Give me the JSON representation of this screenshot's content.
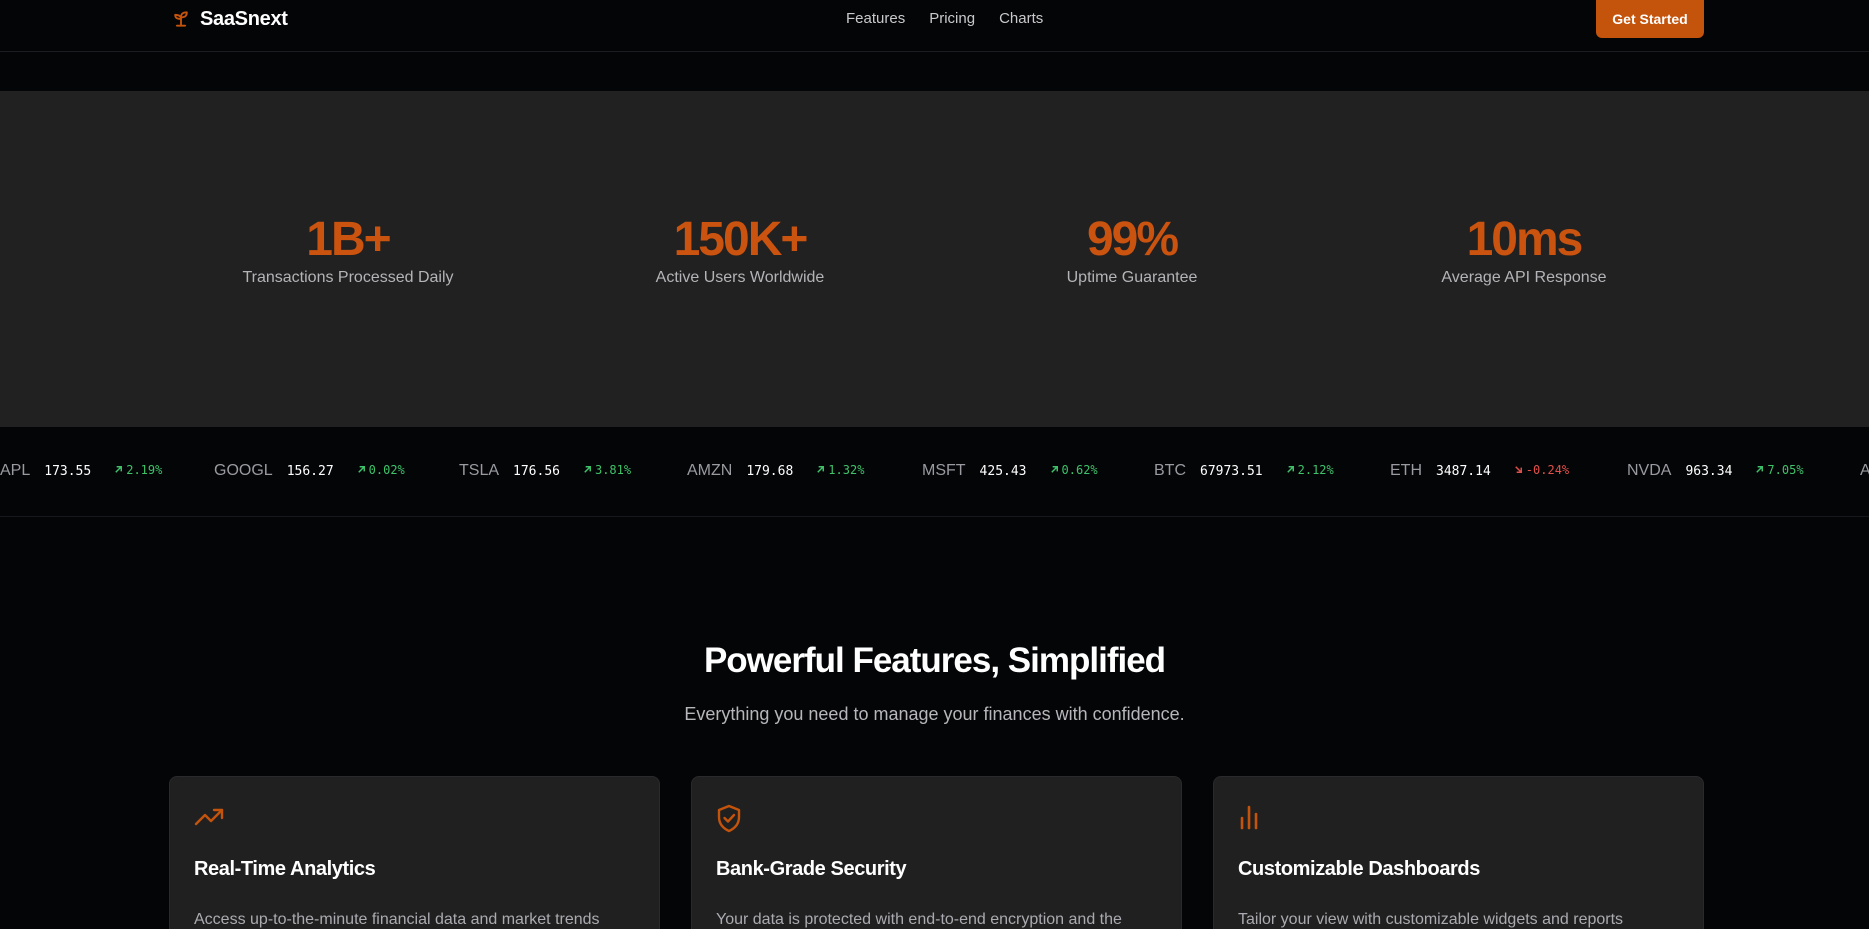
{
  "brand": {
    "name": "SaaSnext",
    "accent_color": "#c4530b"
  },
  "nav": {
    "links": [
      "Features",
      "Pricing",
      "Charts"
    ],
    "cta_label": "Get Started"
  },
  "stats": [
    {
      "value": "1B+",
      "label": "Transactions Processed Daily"
    },
    {
      "value": "150K+",
      "label": "Active Users Worldwide"
    },
    {
      "value": "99%",
      "label": "Uptime Guarantee"
    },
    {
      "value": "10ms",
      "label": "Average API Response"
    }
  ],
  "ticker": [
    {
      "symbol": "APL",
      "price": "173.55",
      "change": "2.19%",
      "direction": "up"
    },
    {
      "symbol": "GOOGL",
      "price": "156.27",
      "change": "0.02%",
      "direction": "up"
    },
    {
      "symbol": "TSLA",
      "price": "176.56",
      "change": "3.81%",
      "direction": "up"
    },
    {
      "symbol": "AMZN",
      "price": "179.68",
      "change": "1.32%",
      "direction": "up"
    },
    {
      "symbol": "MSFT",
      "price": "425.43",
      "change": "0.62%",
      "direction": "up"
    },
    {
      "symbol": "BTC",
      "price": "67973.51",
      "change": "2.12%",
      "direction": "up"
    },
    {
      "symbol": "ETH",
      "price": "3487.14",
      "change": "-0.24%",
      "direction": "down"
    },
    {
      "symbol": "NVDA",
      "price": "963.34",
      "change": "7.05%",
      "direction": "up"
    },
    {
      "symbol": "A",
      "price": "",
      "change": "",
      "direction": "up"
    }
  ],
  "features": {
    "title": "Powerful Features, Simplified",
    "subtitle": "Everything you need to manage your finances with confidence.",
    "cards": [
      {
        "icon": "trending-up-icon",
        "title": "Real-Time Analytics",
        "description": "Access up-to-the-minute financial data and market trends"
      },
      {
        "icon": "shield-check-icon",
        "title": "Bank-Grade Security",
        "description": "Your data is protected with end-to-end encryption and the"
      },
      {
        "icon": "bar-chart-icon",
        "title": "Customizable Dashboards",
        "description": "Tailor your view with customizable widgets and reports"
      }
    ]
  },
  "colors": {
    "up": "#3ec26a",
    "down": "#e0504a",
    "stat_value": "#c9530f"
  }
}
